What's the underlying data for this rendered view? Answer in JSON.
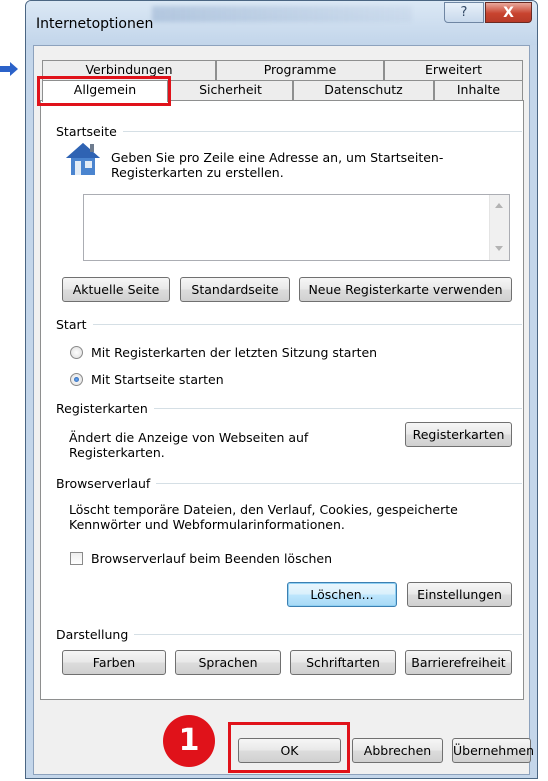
{
  "window": {
    "title": "Internetoptionen",
    "help_glyph": "?",
    "close_glyph": "X"
  },
  "tabs": {
    "row_back": [
      "Verbindungen",
      "Programme",
      "Erweitert"
    ],
    "row_front": [
      "Allgemein",
      "Sicherheit",
      "Datenschutz",
      "Inhalte"
    ],
    "active": "Allgemein"
  },
  "startseite": {
    "group_label": "Startseite",
    "description": "Geben Sie pro Zeile eine Adresse an, um Startseiten-Registerkarten zu erstellen.",
    "textarea_value": "",
    "buttons": {
      "current": "Aktuelle Seite",
      "default": "Standardseite",
      "new_tab": "Neue Registerkarte verwenden"
    }
  },
  "start": {
    "group_label": "Start",
    "options": [
      {
        "label": "Mit Registerkarten der letzten Sitzung starten",
        "selected": false
      },
      {
        "label": "Mit Startseite starten",
        "selected": true
      }
    ]
  },
  "registerkarten": {
    "group_label": "Registerkarten",
    "description": "Ändert die Anzeige von Webseiten auf Registerkarten.",
    "button": "Registerkarten"
  },
  "browserverlauf": {
    "group_label": "Browserverlauf",
    "description": "Löscht temporäre Dateien, den Verlauf, Cookies, gespeicherte Kennwörter und Webformularinformationen.",
    "checkbox_label": "Browserverlauf beim Beenden löschen",
    "checkbox_checked": false,
    "delete_button": "Löschen...",
    "settings_button": "Einstellungen"
  },
  "darstellung": {
    "group_label": "Darstellung",
    "buttons": {
      "colors": "Farben",
      "languages": "Sprachen",
      "fonts": "Schriftarten",
      "accessibility": "Barrierefreiheit"
    }
  },
  "footer": {
    "ok": "OK",
    "cancel": "Abbrechen",
    "apply": "Übernehmen"
  },
  "annotation": {
    "step_number": "1",
    "highlight_color": "#e0121a"
  }
}
